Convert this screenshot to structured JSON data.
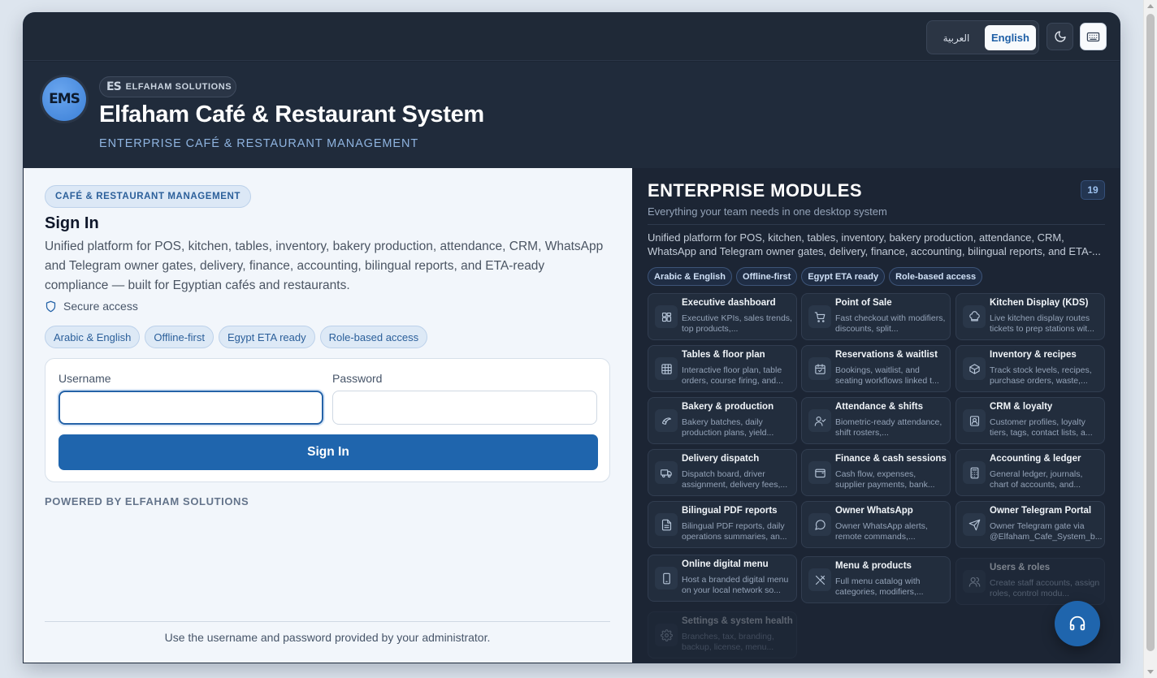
{
  "topbar": {
    "lang_ar": "العربية",
    "lang_en": "English"
  },
  "header": {
    "logo_text": "EMS",
    "brand_mark": "ES",
    "brand_name": "ELFAHAM SOLUTIONS",
    "title": "Elfaham Café & Restaurant System",
    "subtitle": "ENTERPRISE CAFÉ & RESTAURANT MANAGEMENT"
  },
  "login": {
    "tag": "CAFÉ & RESTAURANT MANAGEMENT",
    "heading": "Sign In",
    "description": "Unified platform for POS, kitchen, tables, inventory, bakery production, attendance, CRM, WhatsApp and Telegram owner gates, delivery, finance, accounting, bilingual reports, and ETA-ready compliance — built for Egyptian cafés and restaurants.",
    "secure_label": "Secure access",
    "chips": [
      "Arabic & English",
      "Offline-first",
      "Egypt ETA ready",
      "Role-based access"
    ],
    "username_label": "Username",
    "password_label": "Password",
    "username_value": "",
    "password_value": "",
    "signin_label": "Sign In",
    "powered_by": "POWERED BY ELFAHAM SOLUTIONS",
    "footer_note": "Use the username and password provided by your administrator."
  },
  "modules": {
    "title": "ENTERPRISE MODULES",
    "count": "19",
    "subtitle": "Everything your team needs in one desktop system",
    "description": "Unified platform for POS, kitchen, tables, inventory, bakery production, attendance, CRM, WhatsApp and Telegram owner gates, delivery, finance, accounting, bilingual reports, and ETA-...",
    "chips": [
      "Arabic & English",
      "Offline-first",
      "Egypt ETA ready",
      "Role-based access"
    ],
    "items": [
      {
        "title": "Executive dashboard",
        "desc": "Executive KPIs, sales trends, top products,...",
        "icon": "dashboard-icon"
      },
      {
        "title": "Point of Sale",
        "desc": "Fast checkout with modifiers, discounts, split...",
        "icon": "cart-icon"
      },
      {
        "title": "Kitchen Display (KDS)",
        "desc": "Live kitchen display routes tickets to prep stations wit...",
        "icon": "chef-hat-icon"
      },
      {
        "title": "Tables & floor plan",
        "desc": "Interactive floor plan, table orders, course firing, and...",
        "icon": "grid-icon"
      },
      {
        "title": "Reservations & waitlist",
        "desc": "Bookings, waitlist, and seating workflows linked t...",
        "icon": "calendar-icon"
      },
      {
        "title": "Inventory & recipes",
        "desc": "Track stock levels, recipes, purchase orders, waste,...",
        "icon": "box-icon"
      },
      {
        "title": "Bakery & production",
        "desc": "Bakery batches, daily production plans, yield...",
        "icon": "croissant-icon"
      },
      {
        "title": "Attendance & shifts",
        "desc": "Biometric-ready attendance, shift rosters,...",
        "icon": "user-check-icon"
      },
      {
        "title": "CRM & loyalty",
        "desc": "Customer profiles, loyalty tiers, tags, contact lists, a...",
        "icon": "contact-card-icon"
      },
      {
        "title": "Delivery dispatch",
        "desc": "Dispatch board, driver assignment, delivery fees,...",
        "icon": "truck-icon"
      },
      {
        "title": "Finance & cash sessions",
        "desc": "Cash flow, expenses, supplier payments, bank...",
        "icon": "wallet-icon"
      },
      {
        "title": "Accounting & ledger",
        "desc": "General ledger, journals, chart of accounts, and...",
        "icon": "calculator-icon"
      },
      {
        "title": "Bilingual PDF reports",
        "desc": "Bilingual PDF reports, daily operations summaries, an...",
        "icon": "file-text-icon"
      },
      {
        "title": "Owner WhatsApp",
        "desc": "Owner WhatsApp alerts, remote commands,...",
        "icon": "chat-bubble-icon"
      },
      {
        "title": "Owner Telegram Portal",
        "desc": "Owner Telegram gate via @Elfaham_Cafe_System_b...",
        "icon": "send-icon"
      },
      {
        "title": "Online digital menu",
        "desc": "Host a branded digital menu on your local network so...",
        "icon": "phone-icon"
      },
      {
        "title": "Menu & products",
        "desc": "Full menu catalog with categories, modifiers,...",
        "icon": "utensils-icon"
      },
      {
        "title": "Users & roles",
        "desc": "Create staff accounts, assign roles, control modu...",
        "icon": "users-icon"
      },
      {
        "title": "Settings & system health",
        "desc": "Branches, tax, branding, backup, license, menu...",
        "icon": "gear-icon"
      }
    ]
  }
}
